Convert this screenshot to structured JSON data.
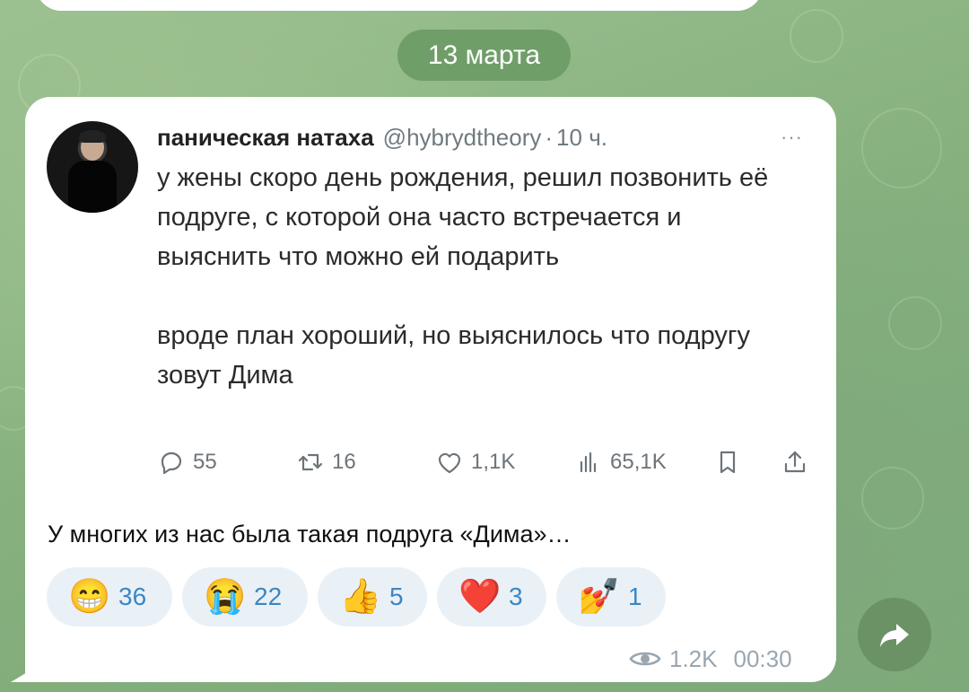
{
  "date_separator": "13 марта",
  "tweet": {
    "author_name": "паническая натаха",
    "handle": "@hybrydtheory",
    "separator": "·",
    "time": "10 ч.",
    "more": "···",
    "paragraphs": [
      "у жены скоро день рождения, решил позвонить её подруге, с которой она часто встречается и выяснить что можно ей подарить",
      "вроде план хороший, но выяснилось что подругу зовут Дима"
    ],
    "actions": {
      "replies": "55",
      "retweets": "16",
      "likes": "1,1K",
      "views": "65,1K"
    }
  },
  "caption": "У многих из нас была такая подруга «Дима»…",
  "reactions": [
    {
      "emoji": "😁",
      "count": "36"
    },
    {
      "emoji": "😭",
      "count": "22"
    },
    {
      "emoji": "👍",
      "count": "5"
    },
    {
      "emoji": "❤️",
      "count": "3"
    },
    {
      "emoji": "💅",
      "count": "1"
    }
  ],
  "meta": {
    "views": "1.2K",
    "time": "00:30"
  },
  "colors": {
    "reaction_text": "#3c86c4",
    "reaction_bg": "#e9f1f7",
    "date_pill": "#6f9e68",
    "meta_text": "#9aa6af"
  },
  "icons": {
    "reply": "reply-icon",
    "retweet": "retweet-icon",
    "like": "heart-icon",
    "views": "bar-chart-icon",
    "bookmark": "bookmark-icon",
    "share": "share-icon",
    "eye": "eye-icon",
    "forward": "forward-arrow-icon"
  }
}
